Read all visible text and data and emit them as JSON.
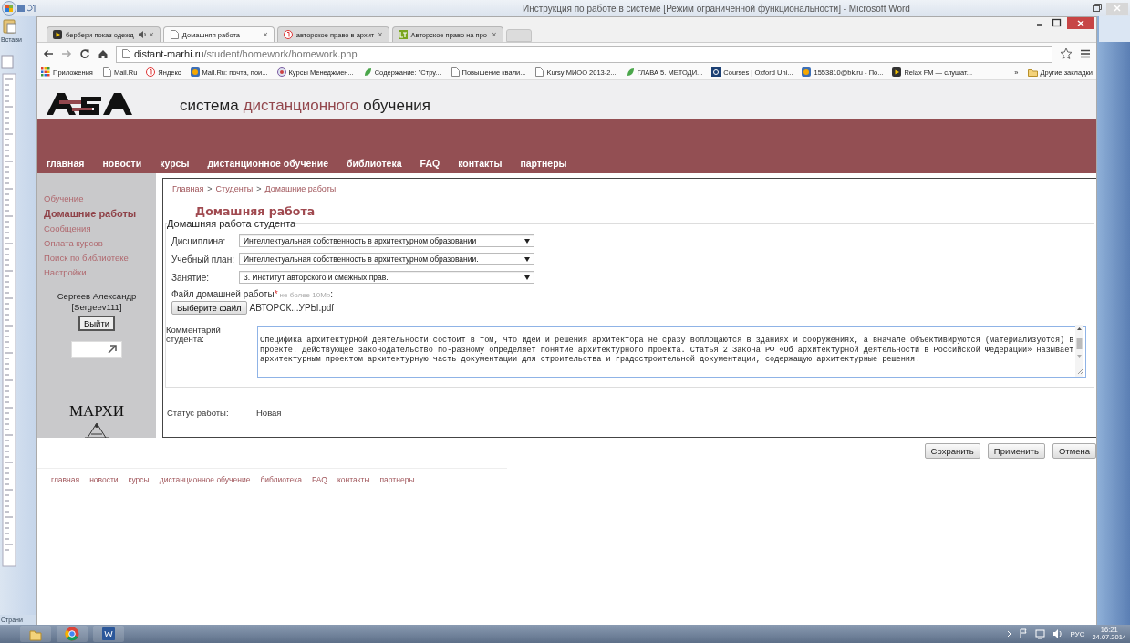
{
  "word": {
    "title": "Инструкция по работе в системе [Режим ограниченной функциональности] - Microsoft Word",
    "paste_label": "Встави",
    "page_label": "Страни"
  },
  "browser": {
    "tabs": [
      {
        "title": "бербери показ одежд",
        "kind": "play",
        "audio": true,
        "selected": false
      },
      {
        "title": "Домашняя работа",
        "kind": "page",
        "audio": false,
        "selected": true
      },
      {
        "title": "авторское право в архит",
        "kind": "yandex",
        "audio": false,
        "selected": false
      },
      {
        "title": "Авторское право на про",
        "kind": "lt",
        "audio": false,
        "selected": false
      }
    ],
    "tab_close": "×",
    "address": {
      "host": "distant-marhi.ru",
      "path": "/student/homework/homework.php"
    },
    "bookmarks": [
      {
        "label": "Приложения",
        "kind": "apps"
      },
      {
        "label": "Mail.Ru",
        "kind": "page"
      },
      {
        "label": "Яндекс",
        "kind": "yandex"
      },
      {
        "label": "Mail.Ru: почта, пои...",
        "kind": "mail"
      },
      {
        "label": "Курсы Менеджмен...",
        "kind": "badge"
      },
      {
        "label": "Содержание: \"Стру...",
        "kind": "leaf"
      },
      {
        "label": "Повышение квали...",
        "kind": "page"
      },
      {
        "label": "Kursy МИОО 2013-2...",
        "kind": "page"
      },
      {
        "label": "ГЛАВА 5. МЕТОДИ...",
        "kind": "leaf"
      },
      {
        "label": "Courses | Oxford Uni...",
        "kind": "oxford"
      },
      {
        "label": "1553810@bk.ru - По...",
        "kind": "mail"
      },
      {
        "label": "Relax FM — слушат...",
        "kind": "play"
      }
    ],
    "more": "»",
    "other_bookmarks": "Другие закладки"
  },
  "site": {
    "title_parts": [
      {
        "text": "система",
        "accent": false
      },
      {
        "text": "дистанционного",
        "accent": true
      },
      {
        "text": "обучения",
        "accent": false
      }
    ],
    "nav": [
      "главная",
      "новости",
      "курсы",
      "дистанционное обучение",
      "библиотека",
      "FAQ",
      "контакты",
      "партнеры"
    ],
    "sidebar": {
      "items": [
        {
          "label": "Обучение",
          "selected": false
        },
        {
          "label": "Домашние работы",
          "selected": true
        },
        {
          "label": "Сообщения",
          "selected": false
        },
        {
          "label": "Оплата курсов",
          "selected": false
        },
        {
          "label": "Поиск по библиотеке",
          "selected": false
        },
        {
          "label": "Настройки",
          "selected": false
        }
      ],
      "user_name": "Сергеев Александр",
      "user_login": "[Sergeev111]",
      "logout": "Выйти",
      "mark": "МАРХИ"
    },
    "breadcrumbs": [
      "Главная",
      "Студенты",
      "Домашние работы"
    ],
    "breadcrumb_separator": ">",
    "heading": "Домашняя работа",
    "legend": "Домашняя работа студента",
    "fields": [
      {
        "label": "Дисциплина:",
        "value": "Интеллектуальная собственность в архитектурном образовании"
      },
      {
        "label": "Учебный план:",
        "value": "Интеллектуальная собственность в архитектурном образовании."
      },
      {
        "label": "Занятие:",
        "value": "3. Институт авторского и смежных прав."
      }
    ],
    "file": {
      "label": "Файл домашней работы",
      "required_mark": "*",
      "hint": "не более 10Mb",
      "colon": ":",
      "button": "Выберите файл",
      "filename": "АВТОРСК...УРЫ.pdf"
    },
    "comment": {
      "label": "Комментарий студента:",
      "value": "Специфика архитектурной деятельности состоит в том, что идеи и решения архитектора не сразу воплощаются в зданиях и сооружениях, а вначале объективируются (материализуются) в проекте. Действующее законодательство по-разному определяет понятие архитектурного проекта. Статья 2 Закона РФ «Об архитектурной деятельности в Российской Федерации» называет архитектурным проектом архитектурную часть документации для строительства и градостроительной документации, содержащую архитектурные решения."
    },
    "status": {
      "label": "Статус работы:",
      "value": "Новая"
    },
    "buttons": [
      "Сохранить",
      "Применить",
      "Отмена"
    ],
    "footer_links": [
      "главная",
      "новости",
      "курсы",
      "дистанционное обучение",
      "библиотека",
      "FAQ",
      "контакты",
      "партнеры"
    ]
  },
  "taskbar": {
    "language": "РУС",
    "time": "16:21",
    "date": "24.07.2014"
  }
}
